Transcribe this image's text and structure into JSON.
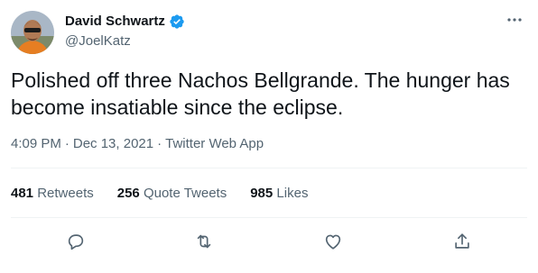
{
  "author": {
    "display_name": "David Schwartz",
    "handle": "@JoelKatz",
    "verified": true
  },
  "tweet": {
    "text": "Polished off three Nachos Bellgrande. The hunger has become insatiable since the eclipse."
  },
  "meta": {
    "time": "4:09 PM",
    "date": "Dec 13, 2021",
    "source": "Twitter Web App",
    "separator": "·"
  },
  "stats": {
    "retweets": {
      "count": "481",
      "label": "Retweets"
    },
    "quote_tweets": {
      "count": "256",
      "label": "Quote Tweets"
    },
    "likes": {
      "count": "985",
      "label": "Likes"
    }
  },
  "icons": {
    "verified": "verified-badge-icon",
    "more": "more-horizontal-icon",
    "reply": "reply-icon",
    "retweet": "retweet-icon",
    "like": "heart-icon",
    "share": "share-icon"
  },
  "colors": {
    "text": "#0f1419",
    "secondary": "#536471",
    "verified": "#1d9bf0",
    "divider": "#eff3f4"
  }
}
